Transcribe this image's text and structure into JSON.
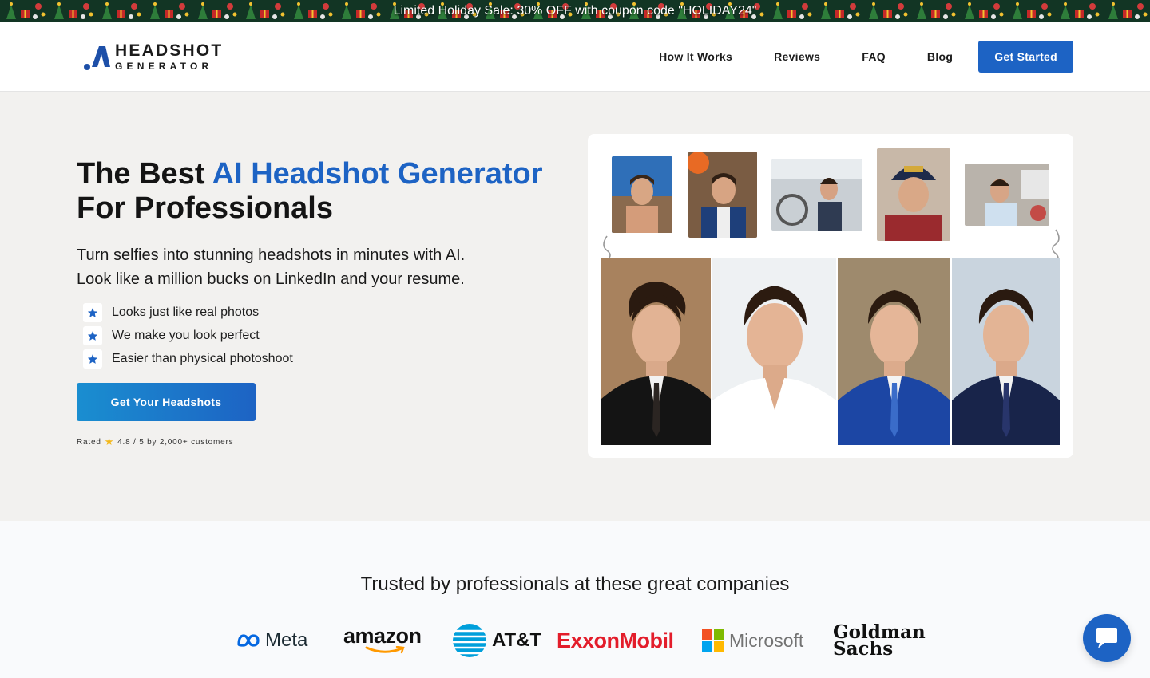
{
  "promo": {
    "text": "Limited Holiday Sale: 30% OFF with coupon code \"HOLIDAY24\""
  },
  "header": {
    "logo_line1": "HEADSHOT",
    "logo_line2": "GENERATOR",
    "nav": [
      "How It Works",
      "Reviews",
      "FAQ",
      "Blog"
    ],
    "cta": "Get Started"
  },
  "hero": {
    "title_pre": "The Best ",
    "title_accent": "AI Headshot Generator",
    "title_post": "For Professionals",
    "subtitle_line1": "Turn selfies into stunning headshots in minutes with AI.",
    "subtitle_line2": "Look like a million bucks on LinkedIn and your resume.",
    "features": [
      "Looks just like real photos",
      "We make you look perfect",
      "Easier than physical photoshoot"
    ],
    "cta": "Get Your Headshots",
    "rating_pre": "Rated",
    "rating_post": "4.8 / 5 by 2,000+ customers"
  },
  "trusted": {
    "title": "Trusted by professionals at these great companies",
    "companies": {
      "meta": "Meta",
      "amazon": "amazon",
      "att": "AT&T",
      "exxon": "ExxonMobil",
      "microsoft": "Microsoft",
      "goldman_line1": "Goldman",
      "goldman_line2": "Sachs"
    }
  },
  "colors": {
    "accent": "#1d63c4",
    "exxon_red": "#e31d2b",
    "promo_bg": "#0f2e1e"
  },
  "icons": {
    "feature": "star-icon",
    "chat": "chat-bubble-icon"
  }
}
